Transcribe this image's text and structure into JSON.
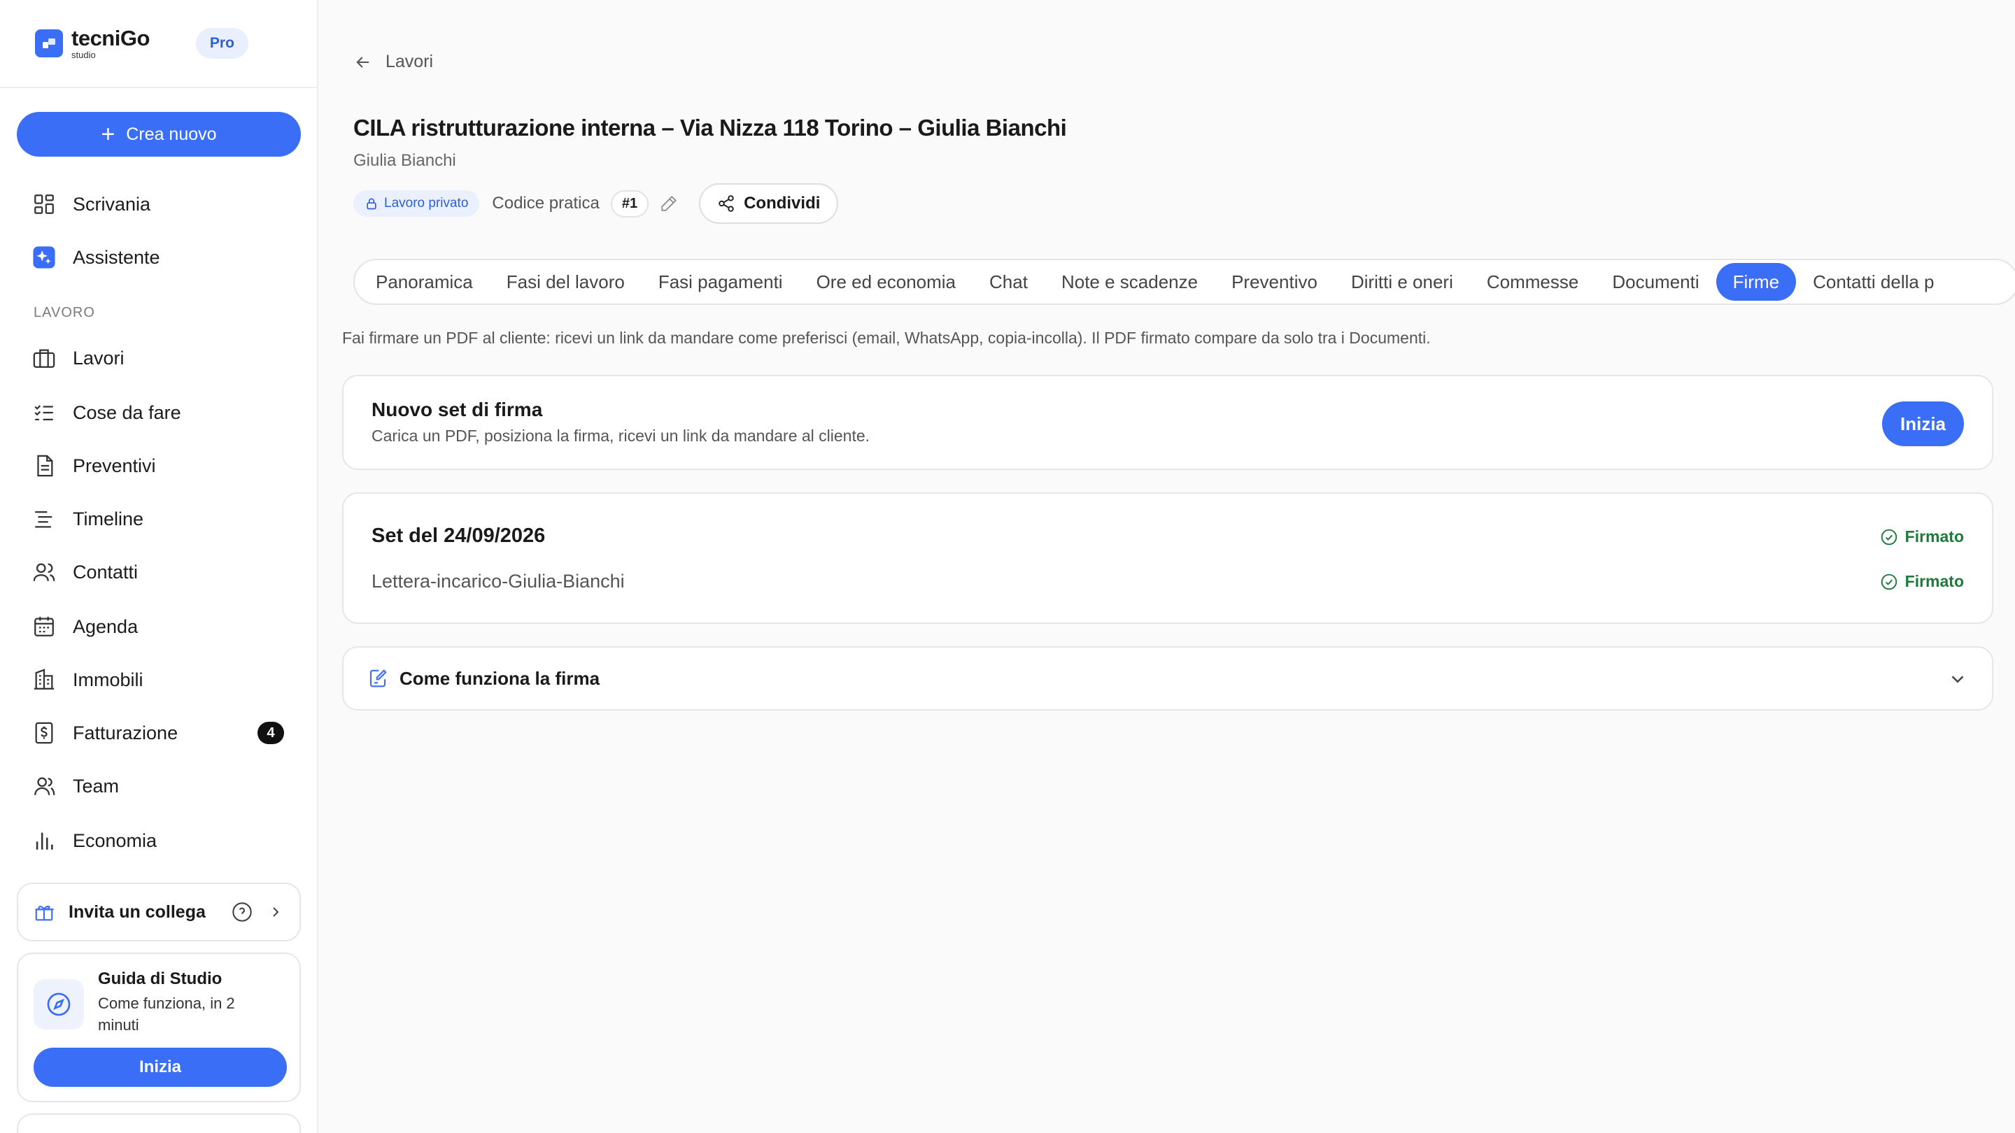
{
  "brand": {
    "name": "tecniGo",
    "sub": "studio",
    "plan": "Pro"
  },
  "sidebar": {
    "create_label": "Crea nuovo",
    "top_items": [
      {
        "label": "Scrivania",
        "icon": "grid-icon"
      },
      {
        "label": "Assistente",
        "icon": "sparkle-icon"
      }
    ],
    "section_label": "LAVORO",
    "items": [
      {
        "label": "Lavori",
        "icon": "briefcase-icon"
      },
      {
        "label": "Cose da fare",
        "icon": "checklist-icon"
      },
      {
        "label": "Preventivi",
        "icon": "document-icon"
      },
      {
        "label": "Timeline",
        "icon": "timeline-icon"
      },
      {
        "label": "Contatti",
        "icon": "users-icon"
      },
      {
        "label": "Agenda",
        "icon": "calendar-icon"
      },
      {
        "label": "Immobili",
        "icon": "building-icon"
      },
      {
        "label": "Fatturazione",
        "icon": "invoice-icon",
        "badge": "4"
      },
      {
        "label": "Team",
        "icon": "team-icon"
      },
      {
        "label": "Economia",
        "icon": "bar-chart-icon"
      }
    ],
    "invite_label": "Invita un collega",
    "guide": {
      "title": "Guida di Studio",
      "desc": "Come funziona, in 2 minuti",
      "button": "Inizia"
    }
  },
  "header": {
    "back_label": "Lavori",
    "title": "CILA ristrutturazione interna – Via Nizza 118 Torino – Giulia Bianchi",
    "subtitle": "Giulia Bianchi",
    "private_label": "Lavoro privato",
    "code_label": "Codice pratica",
    "code_value": "#1",
    "share_label": "Condividi"
  },
  "tabs": [
    {
      "label": "Panoramica"
    },
    {
      "label": "Fasi del lavoro"
    },
    {
      "label": "Fasi pagamenti"
    },
    {
      "label": "Ore ed economia"
    },
    {
      "label": "Chat"
    },
    {
      "label": "Note e scadenze"
    },
    {
      "label": "Preventivo"
    },
    {
      "label": "Diritti e oneri"
    },
    {
      "label": "Commesse"
    },
    {
      "label": "Documenti"
    },
    {
      "label": "Firme",
      "active": true
    },
    {
      "label": "Contatti della p"
    }
  ],
  "firme": {
    "hint": "Fai firmare un PDF al cliente: ricevi un link da mandare come preferisci (email, WhatsApp, copia-incolla). Il PDF firmato compare da solo tra i Documenti.",
    "new_set": {
      "title": "Nuovo set di firma",
      "desc": "Carica un PDF, posiziona la firma, ricevi un link da mandare al cliente.",
      "button": "Inizia"
    },
    "set": {
      "title": "Set del 24/09/2026",
      "status": "Firmato",
      "document": "Lettera-incarico-Giulia-Bianchi",
      "document_status": "Firmato"
    },
    "howto_label": "Come funziona la firma"
  },
  "colors": {
    "accent": "#3b6ef6",
    "success": "#1f7a3a",
    "badge_bg": "#e9effd"
  }
}
